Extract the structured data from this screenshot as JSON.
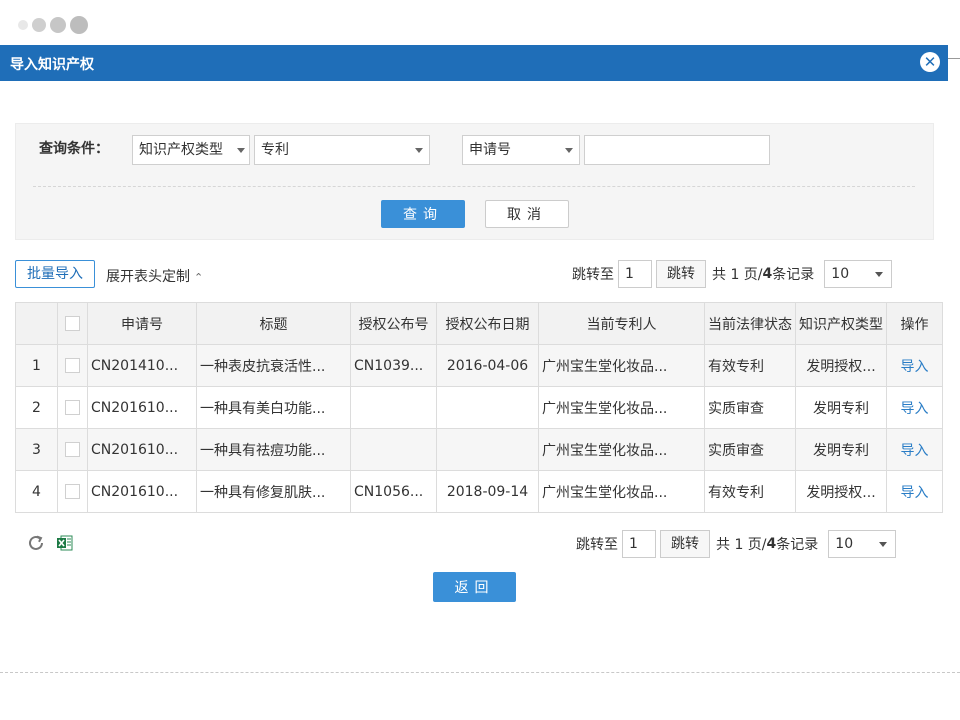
{
  "dialog": {
    "title": "导入知识产权",
    "close_label": "✕"
  },
  "query": {
    "label": "查询条件：",
    "type_select": "知识产权类型",
    "type_value": "专利",
    "field_select": "申请号",
    "field_value": "",
    "search_button": "查询",
    "cancel_button": "取消"
  },
  "toolbar": {
    "batch_import": "批量导入",
    "expand_header": "展开表头定制",
    "expand_chevron": "⌃"
  },
  "pager": {
    "jump_to": "跳转至",
    "page_input": "1",
    "jump_button": "跳转",
    "total_prefix": "共 1 页/",
    "total_count": "4",
    "total_suffix": " 条记录",
    "page_size": "10"
  },
  "table": {
    "headers": [
      "",
      "",
      "申请号",
      "标题",
      "授权公布号",
      "授权公布日期",
      "当前专利人",
      "当前法律状态",
      "知识产权类型",
      "操作"
    ],
    "rows": [
      {
        "index": "1",
        "app_no": "CN201410...",
        "title": "一种表皮抗衰活性...",
        "pub_no": "CN1039...",
        "pub_date": "2016-04-06",
        "holder": "广州宝生堂化妆品...",
        "status": "有效专利",
        "ip_type": "发明授权...",
        "action": "导入"
      },
      {
        "index": "2",
        "app_no": "CN201610...",
        "title": "一种具有美白功能...",
        "pub_no": "",
        "pub_date": "",
        "holder": "广州宝生堂化妆品...",
        "status": "实质审查",
        "ip_type": "发明专利",
        "action": "导入"
      },
      {
        "index": "3",
        "app_no": "CN201610...",
        "title": "一种具有祛痘功能...",
        "pub_no": "",
        "pub_date": "",
        "holder": "广州宝生堂化妆品...",
        "status": "实质审查",
        "ip_type": "发明专利",
        "action": "导入"
      },
      {
        "index": "4",
        "app_no": "CN201610...",
        "title": "一种具有修复肌肤...",
        "pub_no": "CN1056...",
        "pub_date": "2018-09-14",
        "holder": "广州宝生堂化妆品...",
        "status": "有效专利",
        "ip_type": "发明授权...",
        "action": "导入"
      }
    ]
  },
  "footer": {
    "refresh_icon": "refresh-icon",
    "excel_icon": "excel-export-icon",
    "back_button": "返回"
  },
  "colors": {
    "titlebar": "#1f6eb8",
    "primary_button": "#3a90d8",
    "link": "#2a7dc6"
  }
}
